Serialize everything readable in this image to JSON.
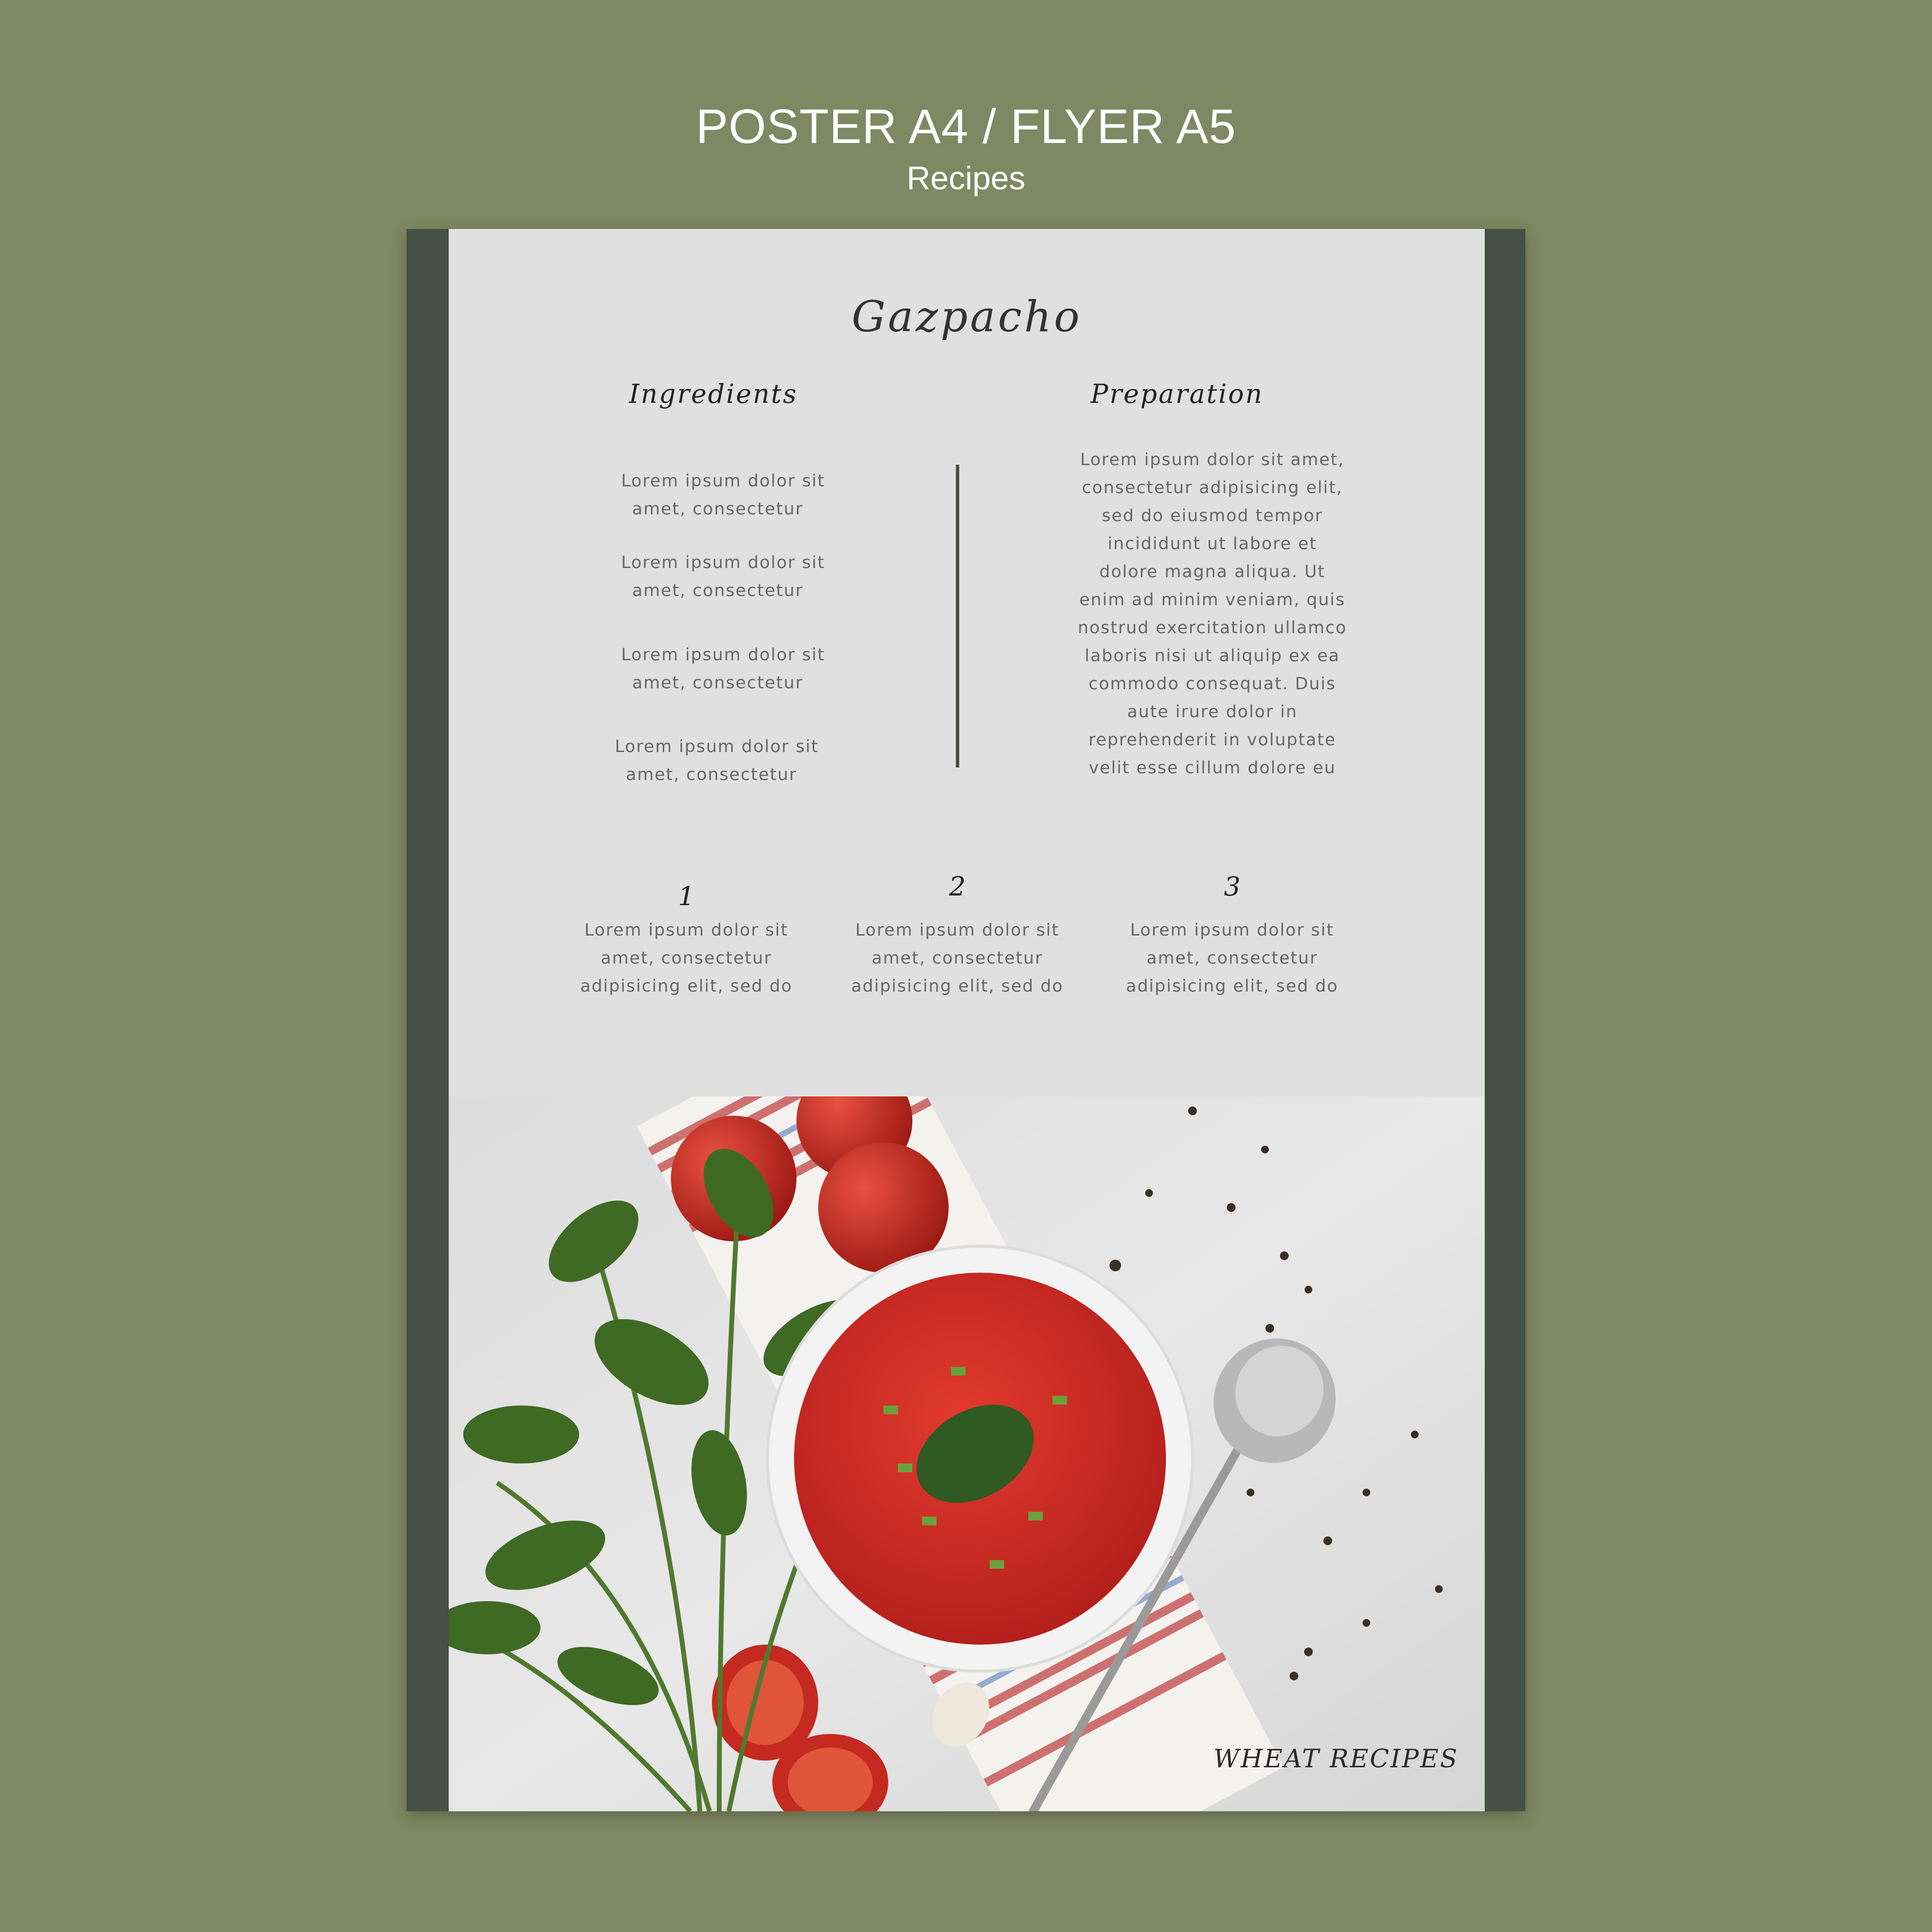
{
  "header": {
    "title": "POSTER A4 / FLYER A5",
    "subtitle": "Recipes"
  },
  "recipe": {
    "title": "Gazpacho",
    "ingredients_heading": "Ingredients",
    "preparation_heading": "Preparation",
    "ingredients": [
      [
        "Lorem ipsum dolor sit",
        "amet, consectetur"
      ],
      [
        "Lorem ipsum dolor sit",
        "amet, consectetur"
      ],
      [
        "Lorem ipsum dolor sit",
        "amet, consectetur"
      ],
      [
        "Lorem ipsum dolor sit",
        "amet, consectetur"
      ]
    ],
    "preparation": [
      "Lorem ipsum dolor sit amet,",
      "consectetur adipisicing elit,",
      "sed do eiusmod tempor",
      "incididunt ut labore et",
      "dolore magna aliqua. Ut",
      "enim ad minim veniam, quis",
      "nostrud exercitation ullamco",
      "laboris nisi ut aliquip ex ea",
      "commodo consequat. Duis",
      "aute irure dolor in",
      "reprehenderit in voluptate",
      "velit esse cillum dolore eu"
    ],
    "steps": [
      {
        "number": "1",
        "lines": [
          "Lorem ipsum dolor sit",
          "amet, consectetur",
          "adipisicing elit, sed do"
        ]
      },
      {
        "number": "2",
        "lines": [
          "Lorem ipsum dolor sit",
          "amet, consectetur",
          "adipisicing elit, sed do"
        ]
      },
      {
        "number": "3",
        "lines": [
          "Lorem ipsum dolor sit",
          "amet, consectetur",
          "adipisicing elit, sed do"
        ]
      }
    ],
    "brand": "WHEAT RECIPES"
  },
  "colors": {
    "background": "#7f8862",
    "band": "#465044",
    "paper": "#e0e0e0"
  }
}
